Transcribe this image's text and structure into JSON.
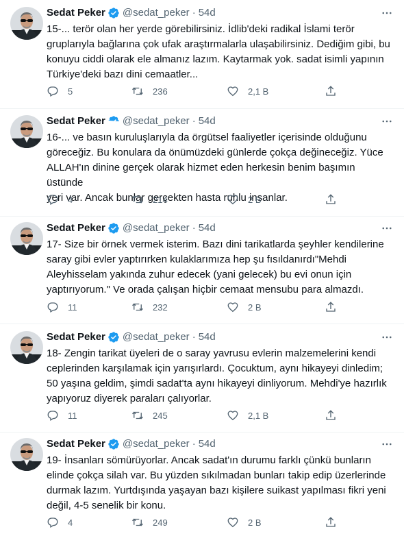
{
  "tweets": [
    {
      "name": "Sedat Peker",
      "handle": "@sedat_peker",
      "separator": "·",
      "time": "54d",
      "text": "15-... terör olan her yerde görebilirsiniz. İdlib'deki radikal İslami terör\ngruplarıyla bağlarına çok ufak araştırmalarla ulaşabilirsiniz. Dediğim gibi, bu\nkonuyu ciddi olarak ele almanız lazım. Kaytarmak yok. sadat isimli yapının\nTürkiye'deki bazı dini cemaatler...",
      "replies": "5",
      "retweets": "236",
      "likes": "2,1 B"
    },
    {
      "name": "Sedat Peker",
      "handle": "@sedat_peker",
      "separator": "·",
      "time": "54d",
      "text": "16-... ve basın kuruluşlarıyla da örgütsel faaliyetler içerisinde olduğunu\ngöreceğiz. Bu konulara da önümüzdeki günlerde çokça değineceğiz. Yüce\nALLAH'ın dinine gerçek olarak hizmet eden herkesin benim başımın üstünde\nyeri var. Ancak bunlar gerçekten hasta ruhlu insanlar.",
      "replies": "4",
      "retweets": "214",
      "likes": "2 B"
    },
    {
      "name": "Sedat Peker",
      "handle": "@sedat_peker",
      "separator": "·",
      "time": "54d",
      "text": "17- Size bir örnek vermek isterim. Bazı dini tarikatlarda şeyhler kendilerine\nsaray gibi evler yaptırırken kulaklarımıza hep şu fısıldanırdı\"Mehdi\nAleyhisselam yakında zuhur edecek (yani gelecek) bu evi onun için\nyaptırıyorum.\" Ve orada çalışan hiçbir cemaat mensubu para almazdı.",
      "replies": "11",
      "retweets": "232",
      "likes": "2 B"
    },
    {
      "name": "Sedat Peker",
      "handle": "@sedat_peker",
      "separator": "·",
      "time": "54d",
      "text": "18- Zengin tarikat üyeleri de o saray yavrusu evlerin malzemelerini kendi\nceplerinden karşılamak için yarışırlardı. Çocuktum, aynı hikayeyi dinledim;\n50 yaşına geldim, şimdi sadat'ta aynı hikayeyi dinliyorum. Mehdi'ye hazırlık\nyapıyoruz diyerek paraları çalıyorlar.",
      "replies": "11",
      "retweets": "245",
      "likes": "2,1 B"
    },
    {
      "name": "Sedat Peker",
      "handle": "@sedat_peker",
      "separator": "·",
      "time": "54d",
      "text": "19- İnsanları sömürüyorlar. Ancak sadat'ın durumu farklı çünkü bunların\nelinde çokça silah var. Bu yüzden sıkılmadan bunları takip edip üzerlerinde\ndurmak lazım. Yurtdışında yaşayan bazı kişilere suikast yapılması fikri yeni\ndeğil, 4-5 senelik bir konu.",
      "replies": "4",
      "retweets": "249",
      "likes": "2 B"
    }
  ],
  "icons": {
    "verified": "verified-badge-icon",
    "more": "more-horizontal-icon",
    "reply": "reply-icon",
    "retweet": "retweet-icon",
    "like": "like-icon",
    "share": "share-icon"
  },
  "colors": {
    "text": "#0f1419",
    "secondary": "#536471",
    "verified": "#1d9bf0",
    "divider": "#eff3f4",
    "thread_line": "#cfd9de"
  }
}
